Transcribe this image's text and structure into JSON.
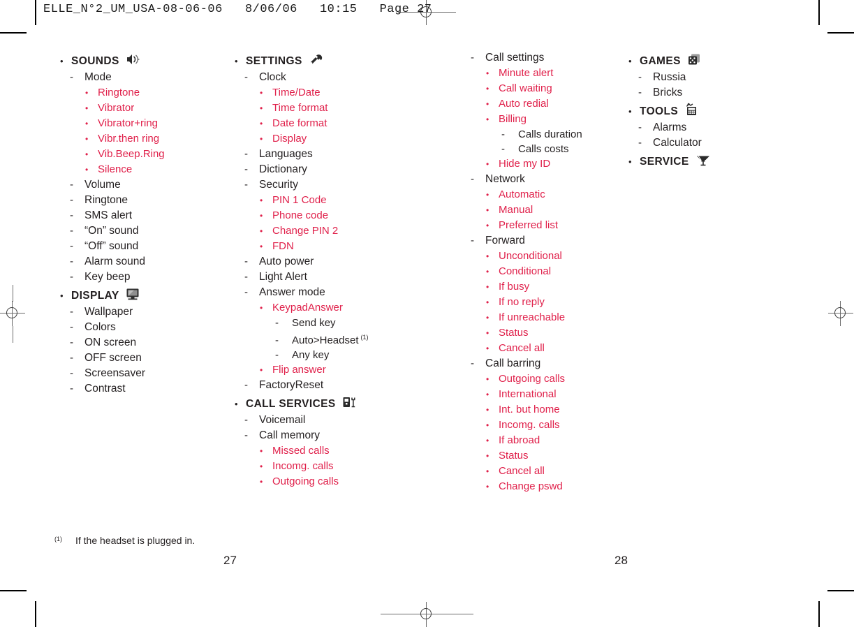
{
  "header": {
    "print_slug": "ELLE_N°2_UM_USA-08-06-06   8/06/06   10:15   Page 27"
  },
  "colors": {
    "accent_red": "#e0214b",
    "body_black": "#231f20"
  },
  "columns": [
    {
      "id": "col1",
      "sections": [
        {
          "label": "SOUNDS",
          "icon": "speaker-icon",
          "children": [
            {
              "label": "Mode",
              "children": [
                {
                  "label": "Ringtone"
                },
                {
                  "label": "Vibrator"
                },
                {
                  "label": "Vibrator+ring"
                },
                {
                  "label": "Vibr.then ring"
                },
                {
                  "label": "Vib.Beep.Ring"
                },
                {
                  "label": "Silence"
                }
              ]
            },
            {
              "label": "Volume"
            },
            {
              "label": "Ringtone"
            },
            {
              "label": "SMS alert"
            },
            {
              "label": "“On” sound"
            },
            {
              "label": "“Off” sound"
            },
            {
              "label": "Alarm sound"
            },
            {
              "label": "Key beep"
            }
          ]
        },
        {
          "label": "DISPLAY",
          "icon": "monitor-icon",
          "children": [
            {
              "label": "Wallpaper"
            },
            {
              "label": "Colors"
            },
            {
              "label": "ON screen"
            },
            {
              "label": "OFF screen"
            },
            {
              "label": "Screensaver"
            },
            {
              "label": "Contrast"
            }
          ]
        }
      ]
    },
    {
      "id": "col2",
      "sections": [
        {
          "label": "SETTINGS",
          "icon": "wrench-icon",
          "children": [
            {
              "label": "Clock",
              "children": [
                {
                  "label": "Time/Date"
                },
                {
                  "label": "Time format"
                },
                {
                  "label": "Date format"
                },
                {
                  "label": "Display"
                }
              ]
            },
            {
              "label": "Languages"
            },
            {
              "label": "Dictionary"
            },
            {
              "label": "Security",
              "children": [
                {
                  "label": "PIN 1 Code"
                },
                {
                  "label": "Phone code"
                },
                {
                  "label": "Change PIN 2"
                },
                {
                  "label": "FDN"
                }
              ]
            },
            {
              "label": "Auto power"
            },
            {
              "label": "Light Alert"
            },
            {
              "label": "Answer mode",
              "children": [
                {
                  "label": "KeypadAnswer",
                  "children": [
                    {
                      "label": "Send key"
                    },
                    {
                      "label": "Auto>Headset",
                      "footnote": "(1)"
                    },
                    {
                      "label": "Any key"
                    }
                  ]
                },
                {
                  "label": "Flip answer"
                }
              ]
            },
            {
              "label": "FactoryReset"
            }
          ]
        },
        {
          "label": "CALL SERVICES",
          "icon": "phone-services-icon",
          "children": [
            {
              "label": "Voicemail"
            },
            {
              "label": "Call memory",
              "children": [
                {
                  "label": "Missed calls"
                },
                {
                  "label": "Incomg. calls"
                },
                {
                  "label": "Outgoing calls"
                }
              ]
            }
          ]
        }
      ]
    },
    {
      "id": "col3",
      "sections": [
        {
          "label": "",
          "icon": "",
          "continued": true,
          "children": [
            {
              "label": "Call settings",
              "children": [
                {
                  "label": "Minute alert"
                },
                {
                  "label": "Call waiting"
                },
                {
                  "label": "Auto redial"
                },
                {
                  "label": "Billing",
                  "children": [
                    {
                      "label": "Calls duration"
                    },
                    {
                      "label": "Calls costs"
                    }
                  ]
                },
                {
                  "label": "Hide my ID"
                }
              ]
            },
            {
              "label": "Network",
              "children": [
                {
                  "label": "Automatic"
                },
                {
                  "label": "Manual"
                },
                {
                  "label": "Preferred list"
                }
              ]
            },
            {
              "label": "Forward",
              "children": [
                {
                  "label": "Unconditional"
                },
                {
                  "label": "Conditional"
                },
                {
                  "label": "If busy"
                },
                {
                  "label": "If no reply"
                },
                {
                  "label": "If unreachable"
                },
                {
                  "label": "Status"
                },
                {
                  "label": "Cancel all"
                }
              ]
            },
            {
              "label": "Call barring",
              "children": [
                {
                  "label": "Outgoing calls"
                },
                {
                  "label": "International"
                },
                {
                  "label": "Int. but home"
                },
                {
                  "label": "Incomg. calls"
                },
                {
                  "label": "If abroad"
                },
                {
                  "label": "Status"
                },
                {
                  "label": "Cancel all"
                },
                {
                  "label": "Change pswd"
                }
              ]
            }
          ]
        }
      ]
    },
    {
      "id": "col4",
      "sections": [
        {
          "label": "GAMES",
          "icon": "dice-icon",
          "children": [
            {
              "label": "Russia"
            },
            {
              "label": "Bricks"
            }
          ]
        },
        {
          "label": "TOOLS",
          "icon": "calculator-icon",
          "children": [
            {
              "label": "Alarms"
            },
            {
              "label": "Calculator"
            }
          ]
        },
        {
          "label": "SERVICE",
          "icon": "funnel-icon",
          "children": []
        }
      ]
    }
  ],
  "footnote": {
    "mark": "(1)",
    "text": "If the headset is plugged in."
  },
  "page_numbers": {
    "left": "27",
    "right": "28"
  },
  "markers": {
    "bullet": "•",
    "dash": "-"
  }
}
